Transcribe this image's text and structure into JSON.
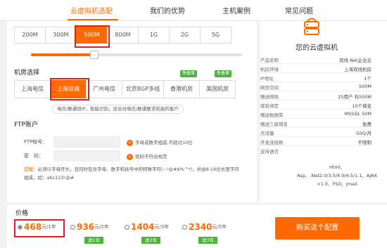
{
  "nav": {
    "tabs": [
      {
        "label": "云虚拟机选配"
      },
      {
        "label": "我们的优势"
      },
      {
        "label": "主机案例"
      },
      {
        "label": "常见问题"
      }
    ]
  },
  "bandwidth": {
    "options": [
      "200M",
      "300M",
      "500M",
      "800M",
      "1G",
      "2G",
      "5G"
    ],
    "selected": "500M",
    "slider_level": 0.31
  },
  "datacenter": {
    "title": "机房选择",
    "options": [
      "上海电信",
      "上海双线",
      "广州电信",
      "北京BGP多线",
      "香港机房",
      "美国机房"
    ],
    "selected": "上海双线",
    "badges": [
      "免备案",
      "免备案"
    ],
    "note": "电信/联通双IP，智能识别，适合对电信/联通要求较高的客户"
  },
  "ftp": {
    "title": "FTP账户",
    "account_label": "FTP帐号：",
    "password_label": "密　码：",
    "account_hint": "字母或数字组成,不超过10位",
    "password_hint": "密码不符合规范",
    "tip_label": "提醒",
    "tip_text": "：必须以字母开头，且同时包含字母、数字和括号中的特殊字符(~!@#$%^*)，并由8-16位长度字符组成，如：abc123!@#"
  },
  "side": {
    "title": "您的云虚拟机",
    "rows": [
      {
        "k": "产品名称",
        "v": "双线.Net企业云"
      },
      {
        "k": "机房环境",
        "v": "上海双线机房"
      },
      {
        "k": "IP地址",
        "v": "1个"
      },
      {
        "k": "网页空间",
        "v": "500M"
      },
      {
        "k": "赠送邮局",
        "v": "25用户 共500M"
      },
      {
        "k": "域名绑定",
        "v": "10个域名"
      },
      {
        "k": "赠送数据库",
        "v": "MSSQL 50M"
      },
      {
        "k": "赠送三级域名",
        "v": "免费"
      },
      {
        "k": "月流量",
        "v": "50G/月"
      },
      {
        "k": "开发连接数",
        "v": "不限制"
      }
    ],
    "support_label": "支持语言",
    "support_text": "Html、Asp、.Net2.0/3.5/4.0/4.5/1.1、AJAX ×1.0、FSO、Jmail"
  },
  "price": {
    "label": "价格",
    "options": [
      {
        "amount": "468",
        "unit": "元/1年",
        "gift": "",
        "selected": true
      },
      {
        "amount": "936",
        "unit": "元/2年",
        "gift": "送1年",
        "selected": false
      },
      {
        "amount": "1404",
        "unit": "元/3年",
        "gift": "送2年",
        "selected": false
      },
      {
        "amount": "2340",
        "unit": "元/5年",
        "gift": "送3年",
        "selected": false
      }
    ],
    "buy_label": "购买这个配置"
  },
  "colors": {
    "accent": "#ff6a00",
    "highlight_box": "#e02020",
    "gift": "#4db33d"
  }
}
